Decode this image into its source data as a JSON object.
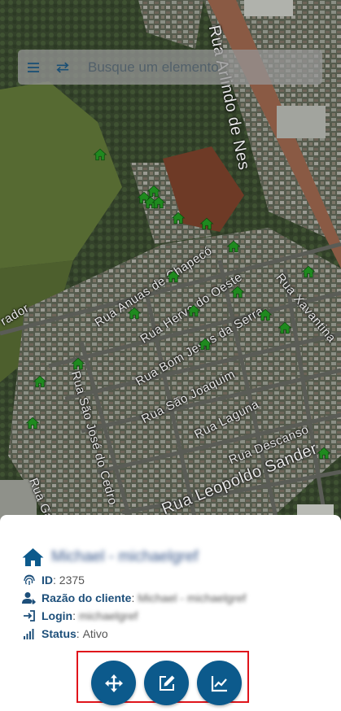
{
  "map": {
    "streets": [
      "Rua Arlindo de Nes",
      "Rua Anuas de Chapecó",
      "Rua Hervo do Oeste",
      "Rua Bom Jesus da Serra",
      "Rua São Joaquim",
      "Rua Laguna",
      "Rua Descanso",
      "Rua Leopoldo Sander",
      "Rua São José do Cedro",
      "Rua Xavantina",
      "rador",
      "Rua Gas"
    ],
    "marker_color": "#1f8a1f",
    "marker_icon": "home-icon"
  },
  "search": {
    "placeholder": "Busque um elemento",
    "menu_icon": "menu-icon",
    "swap_icon": "swap-icon"
  },
  "panel": {
    "title": "Michael - michaelgref",
    "id_label": "ID",
    "id_value": "2375",
    "client_label": "Razão do cliente",
    "client_value": "Michael - michaelgref",
    "login_label": "Login",
    "login_value": "michaelgref",
    "status_label": "Status",
    "status_value": "Ativo",
    "actions": [
      {
        "name": "move-button",
        "icon": "move-icon"
      },
      {
        "name": "edit-button",
        "icon": "edit-icon"
      },
      {
        "name": "chart-button",
        "icon": "chart-icon"
      }
    ],
    "accent_color": "#0c5a8c",
    "label_color": "#1d4f7a"
  }
}
